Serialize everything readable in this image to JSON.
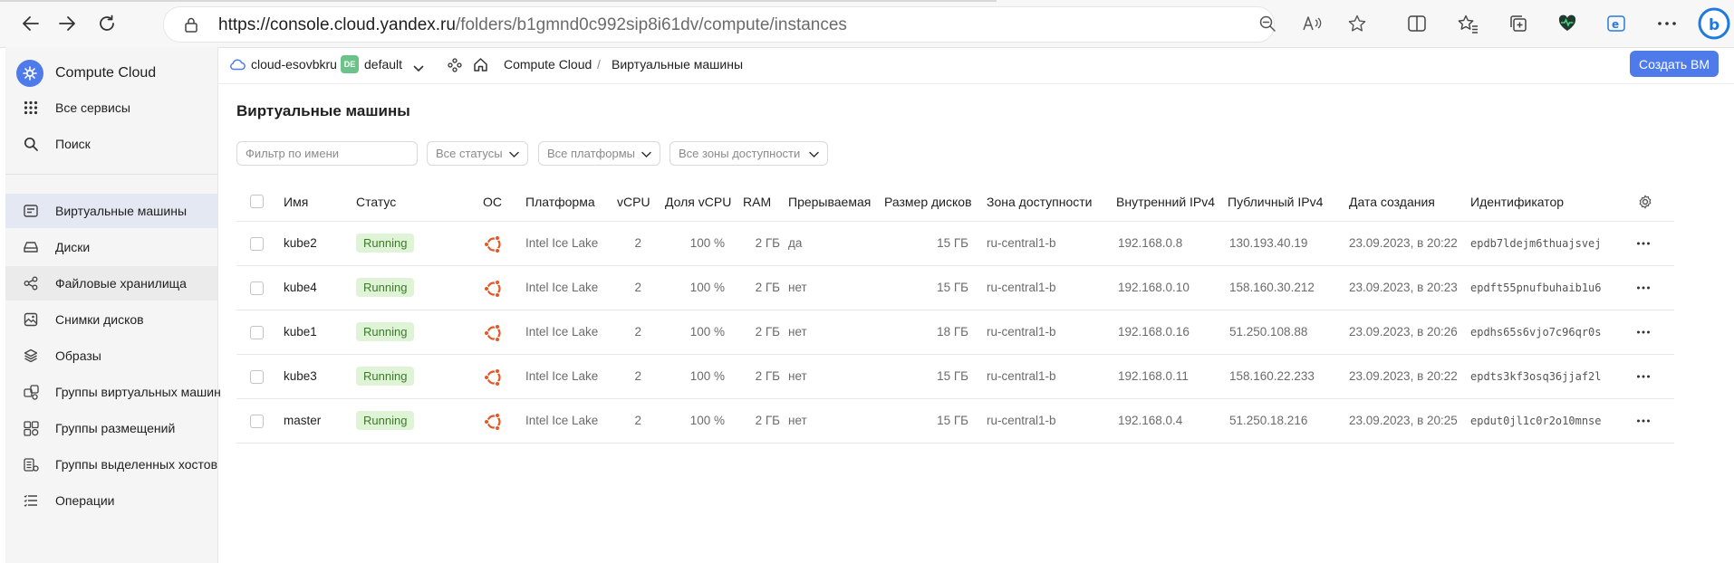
{
  "browser": {
    "url_main": "https://console.cloud.yandex.ru",
    "url_path": "/folders/b1gmnd0c992sip8i61dv/compute/instances"
  },
  "sidebar": {
    "brand": "Compute Cloud",
    "top_items": [
      {
        "label": "Все сервисы",
        "icon": "grid-icon"
      },
      {
        "label": "Поиск",
        "icon": "search-icon"
      }
    ],
    "items": [
      {
        "label": "Виртуальные машины",
        "icon": "vm-icon"
      },
      {
        "label": "Диски",
        "icon": "disk-icon"
      },
      {
        "label": "Файловые хранилища",
        "icon": "share-icon"
      },
      {
        "label": "Снимки дисков",
        "icon": "image-icon"
      },
      {
        "label": "Образы",
        "icon": "layers-icon"
      },
      {
        "label": "Группы виртуальных машин",
        "icon": "vm-group-icon"
      },
      {
        "label": "Группы размещений",
        "icon": "placement-icon"
      },
      {
        "label": "Группы выделенных хостов",
        "icon": "hosts-icon"
      },
      {
        "label": "Операции",
        "icon": "list-icon"
      }
    ]
  },
  "header": {
    "cloud": "cloud-esovbkru",
    "env_badge": "DE",
    "folder": "default",
    "breadcrumb_service": "Compute Cloud",
    "breadcrumb_sep": "/",
    "breadcrumb_current": "Виртуальные машины",
    "create_button": "Создать ВМ"
  },
  "main": {
    "title": "Виртуальные машины",
    "filters": {
      "name_placeholder": "Фильтр по имени",
      "status": "Все статусы",
      "platform": "Все платформы",
      "zone": "Все зоны доступности"
    },
    "columns": [
      "Имя",
      "Статус",
      "ОС",
      "Платформа",
      "vCPU",
      "Доля vCPU",
      "RAM",
      "Прерываемая",
      "Размер дисков",
      "Зона доступности",
      "Внутренний IPv4",
      "Публичный IPv4",
      "Дата создания",
      "Идентификатор"
    ],
    "rows": [
      {
        "name": "kube2",
        "status": "Running",
        "platform": "Intel Ice Lake",
        "vcpu": "2",
        "vcpu_share": "100 %",
        "ram": "2 ГБ",
        "preemptible": "да",
        "disk": "15 ГБ",
        "zone": "ru-central1-b",
        "internal_ip": "192.168.0.8",
        "public_ip": "130.193.40.19",
        "created": "23.09.2023, в 20:22",
        "id": "epdb7ldejm6thuajsvej"
      },
      {
        "name": "kube4",
        "status": "Running",
        "platform": "Intel Ice Lake",
        "vcpu": "2",
        "vcpu_share": "100 %",
        "ram": "2 ГБ",
        "preemptible": "нет",
        "disk": "15 ГБ",
        "zone": "ru-central1-b",
        "internal_ip": "192.168.0.10",
        "public_ip": "158.160.30.212",
        "created": "23.09.2023, в 20:23",
        "id": "epdft55pnufbuhaib1u6"
      },
      {
        "name": "kube1",
        "status": "Running",
        "platform": "Intel Ice Lake",
        "vcpu": "2",
        "vcpu_share": "100 %",
        "ram": "2 ГБ",
        "preemptible": "нет",
        "disk": "18 ГБ",
        "zone": "ru-central1-b",
        "internal_ip": "192.168.0.16",
        "public_ip": "51.250.108.88",
        "created": "23.09.2023, в 20:26",
        "id": "epdhs65s6vjo7c96qr0s"
      },
      {
        "name": "kube3",
        "status": "Running",
        "platform": "Intel Ice Lake",
        "vcpu": "2",
        "vcpu_share": "100 %",
        "ram": "2 ГБ",
        "preemptible": "нет",
        "disk": "15 ГБ",
        "zone": "ru-central1-b",
        "internal_ip": "192.168.0.11",
        "public_ip": "158.160.22.233",
        "created": "23.09.2023, в 20:22",
        "id": "epdts3kf3osq36jjaf2l"
      },
      {
        "name": "master",
        "status": "Running",
        "platform": "Intel Ice Lake",
        "vcpu": "2",
        "vcpu_share": "100 %",
        "ram": "2 ГБ",
        "preemptible": "нет",
        "disk": "15 ГБ",
        "zone": "ru-central1-b",
        "internal_ip": "192.168.0.4",
        "public_ip": "51.250.18.216",
        "created": "23.09.2023, в 20:25",
        "id": "epdut0jl1c0r2o10mnse"
      }
    ]
  },
  "colors": {
    "accent": "#4f7bea",
    "status_running_bg": "#dff3d6",
    "status_running_fg": "#3c7a2a",
    "ubuntu": "#e95420"
  }
}
